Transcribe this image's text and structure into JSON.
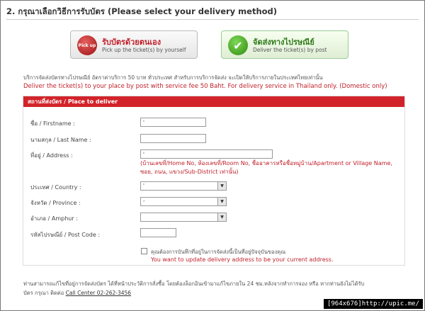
{
  "step_title": "2. กรุณาเลือกวิธีการรับบัตร (Please select your delivery method)",
  "options": {
    "pickup": {
      "title_th": "รับบัตรด้วยตนเอง",
      "subtitle_en": "Pick up the ticket(s) by yourself",
      "icon_label": "Pick up"
    },
    "post": {
      "title_th": "จัดส่งทางไปรษณีย์",
      "subtitle_en": "Deliver the ticket(s) by post",
      "icon_label": "✔"
    }
  },
  "info": {
    "th": "บริการจัดส่งบัตรทางไปรษณีย์ อัตราค่าบริการ 50 บาท ทั่วประเทศ สำหรับการบริการจัดส่ง จะเปิดให้บริการภายในประเทศไทยเท่านั้น",
    "en": "Deliver the ticket(s) to your place by post with service fee 50 Baht. For delivery service in Thailand only. (Domestic only)"
  },
  "panel": {
    "header": "สถานที่ส่งบัตร / Place to deliver",
    "fields": {
      "firstname_label": "ชื่อ / Firstname :",
      "firstname_value": "'",
      "lastname_label": "นามสกุล / Last Name :",
      "lastname_value": "",
      "address_label": "ที่อยู่ / Address :",
      "address_value": "'",
      "address_hint": "(บ้านเลขที่/Home No, ห้องเลขที่/Room No, ชื่ออาคารหรือชื่อหมู่บ้าน/Apartment or Village Name, ซอย, ถนน, แขวง/Sub-District เท่านั้น)",
      "country_label": "ประเทศ / Country :",
      "country_value": "'",
      "province_label": "จังหวัด / Province :",
      "province_value": "-",
      "amphur_label": "อำเภอ / Amphur :",
      "amphur_value": "",
      "postcode_label": "รหัสไปรษณีย์ / Post Code :",
      "postcode_value": ""
    },
    "update_th": "คุณต้องการบันทึกที่อยู่ในการจัดส่งนี้เป็นที่อยู่ปัจจุบันของคุณ",
    "update_en": "You want to update delivery address to be your current address."
  },
  "footer": {
    "line1": "ท่านสามารถแก้ไขที่อยู่การจัดส่งบัตร ได้ที่หน้าประวัติการสั่งซื้อ โดยต้องล็อกอินเข้ามาแก้ไขภายใน 24 ชม.หลังจากทำการจอง หรือ หากท่านยังไม่ได้รับ",
    "line2_prefix": "บัตร กรุณา ติดต่อ",
    "call_center": "Call Center 02-262-3456"
  },
  "watermark": "[964x676]http://upic.me/"
}
